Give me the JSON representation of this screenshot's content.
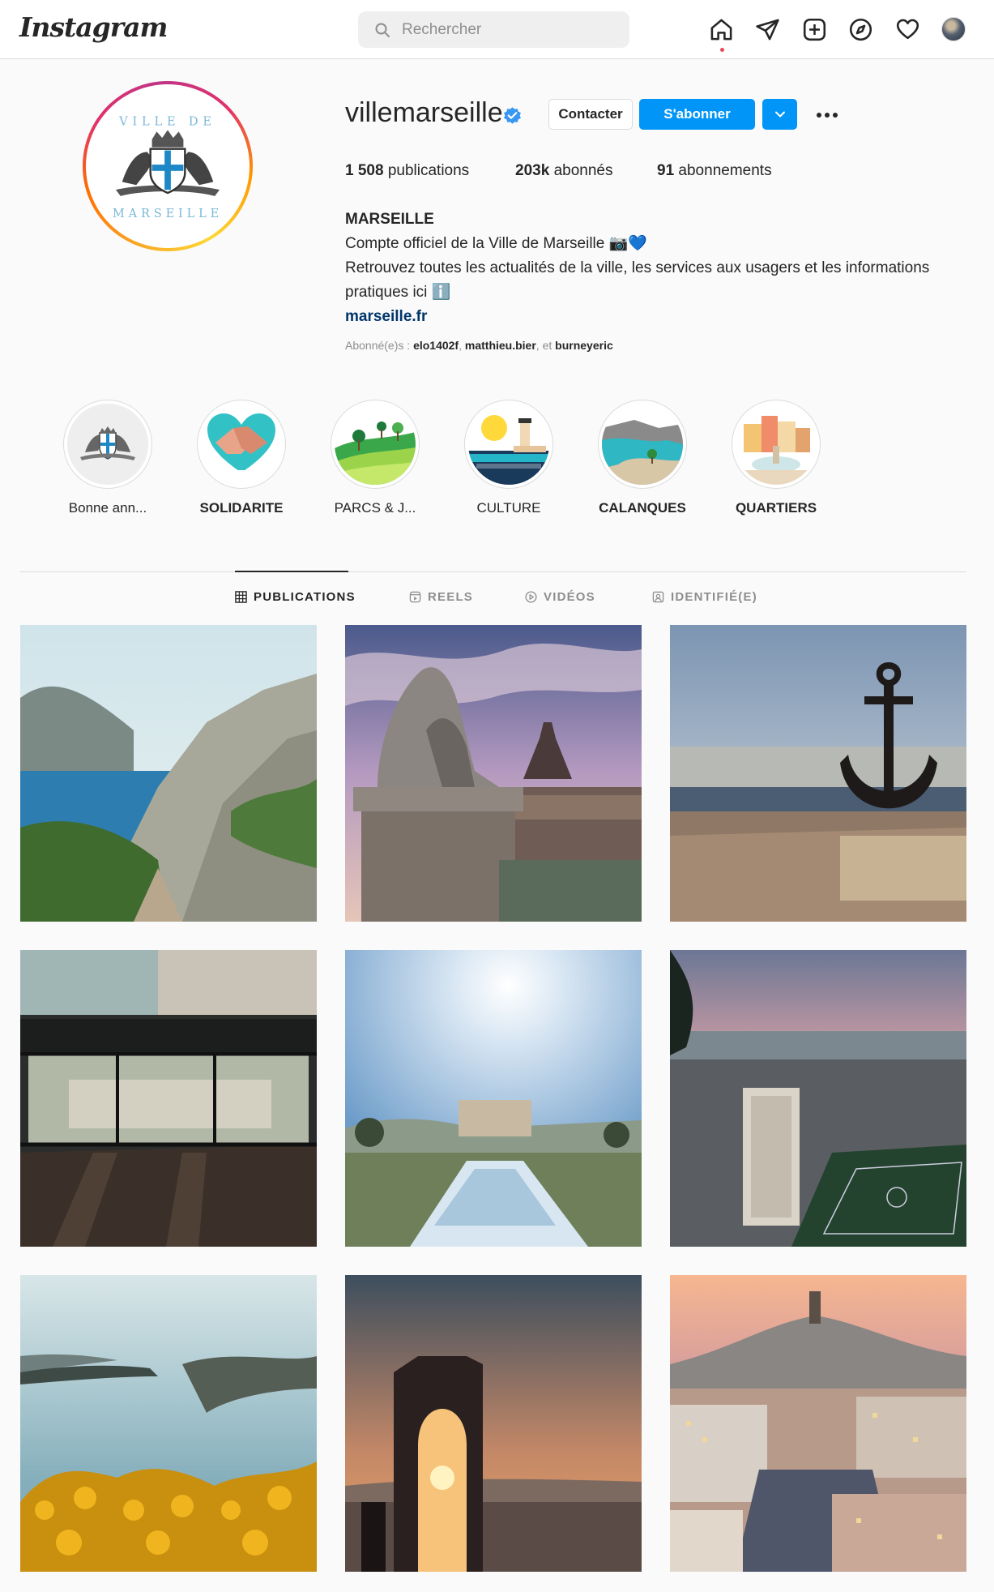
{
  "app": {
    "logo_text": "Instagram"
  },
  "search": {
    "placeholder": "Rechercher"
  },
  "nav": {
    "icons": [
      "home-icon",
      "direct-icon",
      "new-post-icon",
      "explore-icon",
      "activity-icon",
      "profile-avatar"
    ]
  },
  "profile": {
    "username": "villemarseille",
    "verified": true,
    "buttons": {
      "contact": "Contacter",
      "follow": "S'abonner"
    },
    "stats": {
      "posts_count": "1 508",
      "posts_label": "publications",
      "followers_count": "203k",
      "followers_label": "abonnés",
      "following_count": "91",
      "following_label": "abonnements"
    },
    "bio": {
      "name": "MARSEILLE",
      "line1": "Compte officiel de la Ville de Marseille 📷💙",
      "line2": "Retrouvez toutes les actualités de la ville, les services aux usagers et les informations pratiques ici ℹ️",
      "link": "marseille.fr"
    },
    "followed_by": {
      "prefix": "Abonné(e)s : ",
      "users": [
        "elo1402f",
        "matthieu.bier"
      ],
      "separator": ", ",
      "conjunction": ", et ",
      "last": "burneyeric"
    },
    "logo_text_top": "VILLE DE",
    "logo_text_bottom": "MARSEILLE"
  },
  "highlights": [
    {
      "label": "Bonne ann...",
      "icon": "city-crest"
    },
    {
      "label": "SOLIDARITE",
      "icon": "handshake-heart"
    },
    {
      "label": "PARCS & J...",
      "icon": "park-trees"
    },
    {
      "label": "CULTURE",
      "icon": "lighthouse-sun"
    },
    {
      "label": "CALANQUES",
      "icon": "calanques-coast"
    },
    {
      "label": "QUARTIERS",
      "icon": "fountain-square"
    }
  ],
  "tabs": [
    {
      "label": "PUBLICATIONS",
      "icon": "grid-icon",
      "active": true
    },
    {
      "label": "REELS",
      "icon": "reels-icon",
      "active": false
    },
    {
      "label": "VIDÉOS",
      "icon": "play-icon",
      "active": false
    },
    {
      "label": "IDENTIFIÉ(E)",
      "icon": "tagged-icon",
      "active": false
    }
  ],
  "posts": [
    {
      "subject": "calanques cliff path"
    },
    {
      "subject": "lion statue and notre-dame"
    },
    {
      "subject": "anchor monument at port"
    },
    {
      "subject": "building ruins through glass"
    },
    {
      "subject": "chateau borely fountain"
    },
    {
      "subject": "city sunset and stadium"
    },
    {
      "subject": "sea coast with yellow flowers"
    },
    {
      "subject": "monument arch at sunset"
    },
    {
      "subject": "old port and notre-dame"
    }
  ],
  "colors": {
    "accent": "#0095f6",
    "link": "#00376b",
    "border": "#dbdbdb",
    "background": "#fafafa"
  }
}
